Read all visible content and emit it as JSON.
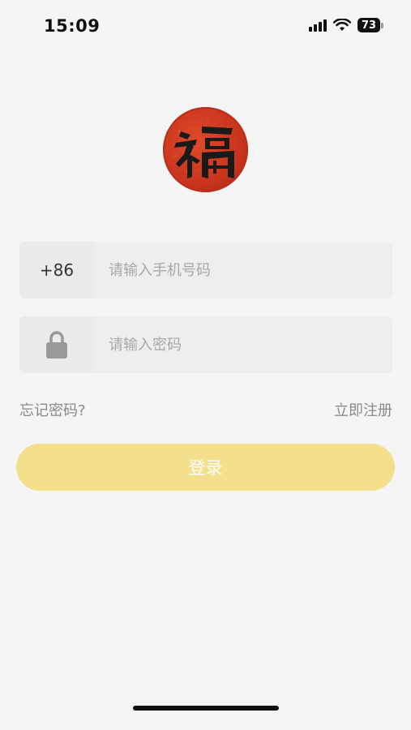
{
  "status_bar": {
    "time": "15:09",
    "battery_level": "73",
    "icons": [
      "signal-icon",
      "wifi-icon",
      "battery-icon"
    ]
  },
  "logo": {
    "character": "福",
    "icon": "fu-logo-icon",
    "color": "#c8341c"
  },
  "phone_field": {
    "country_code": "+86",
    "placeholder": "请输入手机号码",
    "value": ""
  },
  "password_field": {
    "icon": "lock-icon",
    "placeholder": "请输入密码",
    "value": ""
  },
  "links": {
    "forgot_password": "忘记密码?",
    "register": "立即注册"
  },
  "login_button": {
    "label": "登录",
    "color": "#f4df8c"
  }
}
